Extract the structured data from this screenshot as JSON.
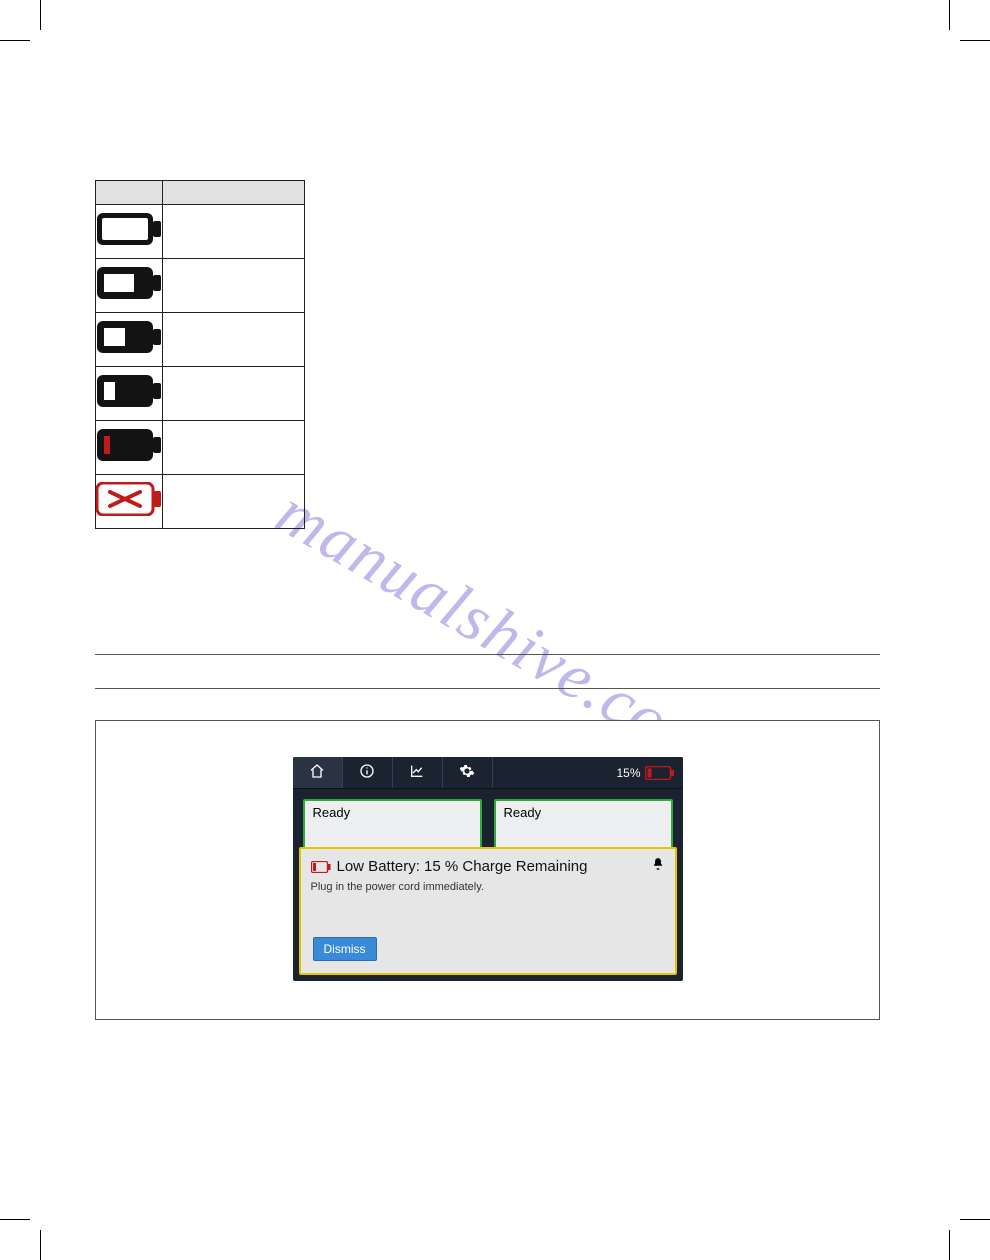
{
  "watermark": "manualshive.com",
  "battery_table": {
    "header": {
      "icon": "",
      "description": ""
    },
    "rows": [
      {
        "icon_name": "battery-100-icon",
        "fill": 1.0,
        "color": "#ffffff",
        "description": ""
      },
      {
        "icon_name": "battery-75-icon",
        "fill": 0.7,
        "color": "#ffffff",
        "description": ""
      },
      {
        "icon_name": "battery-50-icon",
        "fill": 0.5,
        "color": "#ffffff",
        "description": ""
      },
      {
        "icon_name": "battery-25-icon",
        "fill": 0.25,
        "color": "#ffffff",
        "description": ""
      },
      {
        "icon_name": "battery-low-icon",
        "fill": 0.12,
        "color": "#c11a1a",
        "description": ""
      },
      {
        "icon_name": "battery-fault-icon",
        "fill": 0,
        "color": "#c11a1a",
        "fault": true,
        "description": ""
      }
    ]
  },
  "device": {
    "topbar": {
      "tabs": [
        {
          "name": "home-tab",
          "icon": "home-icon"
        },
        {
          "name": "info-tab",
          "icon": "info-icon"
        },
        {
          "name": "chart-tab",
          "icon": "chart-icon"
        },
        {
          "name": "gear-tab",
          "icon": "gear-icon"
        }
      ],
      "percent_text": "15%",
      "battery_icon": "battery-low-icon"
    },
    "tiles": [
      {
        "title": "Ready"
      },
      {
        "title": "Ready"
      }
    ],
    "alert": {
      "icon": "battery-low-icon",
      "title": "Low Battery: 15 % Charge Remaining",
      "bell_icon": "bell-icon",
      "message": "Plug in the power cord immediately.",
      "dismiss_label": "Dismiss"
    }
  }
}
